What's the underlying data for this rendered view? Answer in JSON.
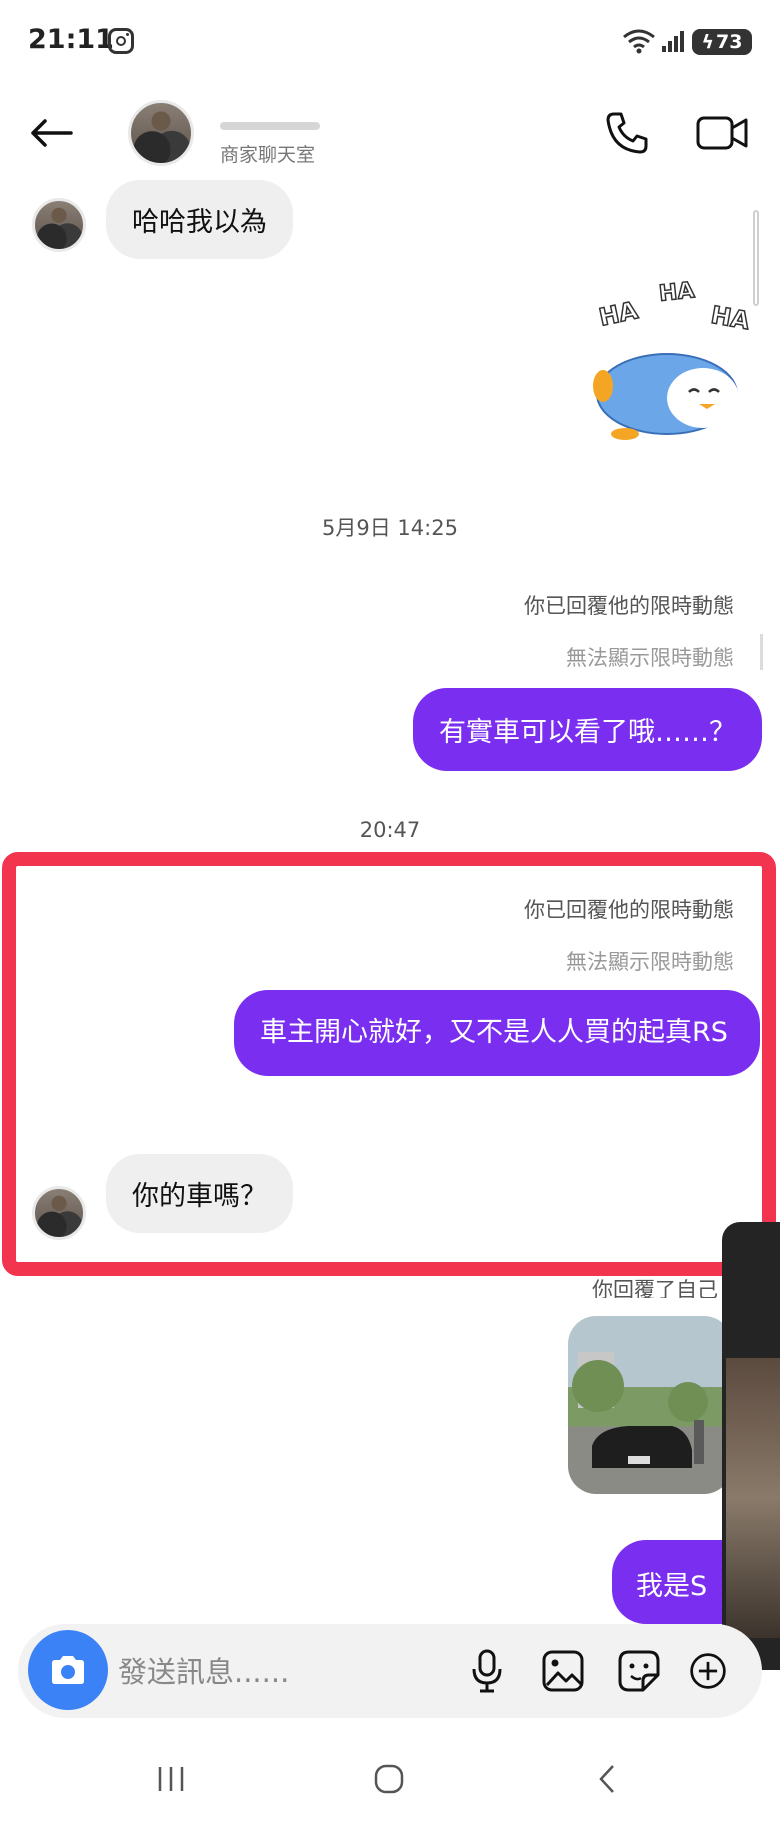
{
  "status_bar": {
    "time": "21:11",
    "battery": "73"
  },
  "header": {
    "subtitle": "商家聊天室"
  },
  "messages": {
    "m1_incoming": "哈哈我以為",
    "sticker_ha1": "HA",
    "sticker_ha2": "HA",
    "sticker_ha3": "HA",
    "time_1": "5月9日 14:25",
    "reply_note_1": "你已回覆他的限時動態",
    "unavailable_1": "無法顯示限時動態",
    "m2_outgoing": "有實車可以看了哦……？",
    "time_2": "20:47",
    "reply_note_2": "你已回覆他的限時動態",
    "unavailable_2": "無法顯示限時動態",
    "m3_outgoing": "車主開心就好，又不是人人買的起真RS",
    "m4_incoming": "你的車嗎？",
    "reply_note_3_partial": "你回覆了自己",
    "m5_outgoing_partial": "我是S"
  },
  "composer": {
    "placeholder": "發送訊息......"
  },
  "colors": {
    "accent": "#7a2ef0",
    "highlight": "#f2344f",
    "camera": "#3b82f6"
  },
  "icons": [
    "back-arrow-icon",
    "phone-icon",
    "video-camera-icon",
    "camera-icon",
    "microphone-icon",
    "image-icon",
    "sticker-icon",
    "plus-icon",
    "recent-apps-icon",
    "home-icon",
    "nav-back-icon"
  ]
}
